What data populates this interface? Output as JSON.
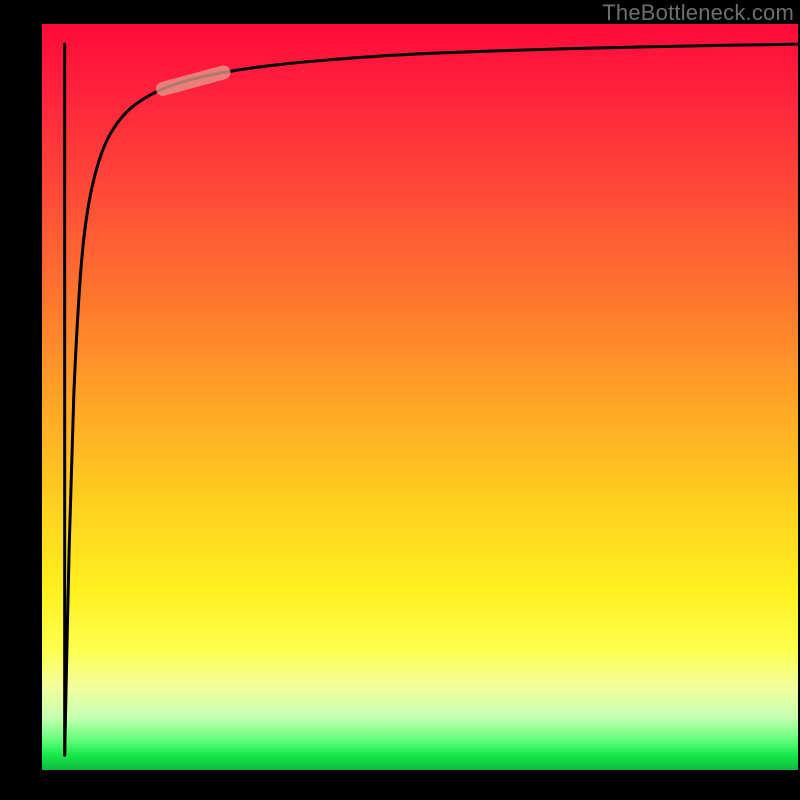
{
  "watermark": "TheBottleneck.com",
  "chart_data": {
    "type": "line",
    "title": "",
    "xlabel": "",
    "ylabel": "",
    "xlim": [
      0,
      100
    ],
    "ylim": [
      0,
      100
    ],
    "grid": false,
    "legend": false,
    "annotations": [],
    "series": [
      {
        "name": "bottleneck-curve",
        "x": [
          3.0,
          3.6,
          4.2,
          4.8,
          5.4,
          6.2,
          7.2,
          8.4,
          9.8,
          11.5,
          13.5,
          16.0,
          19.5,
          24.0,
          30.0,
          38.0,
          48.0,
          60.0,
          74.0,
          88.0,
          100.0
        ],
        "y": [
          2.0,
          30.0,
          50.0,
          62.0,
          70.0,
          76.0,
          80.5,
          84.0,
          86.5,
          88.5,
          90.0,
          91.3,
          92.5,
          93.5,
          94.4,
          95.2,
          95.9,
          96.4,
          96.8,
          97.1,
          97.3
        ]
      },
      {
        "name": "vertical-drop",
        "x": [
          3.0,
          3.0
        ],
        "y": [
          97.3,
          2.0
        ]
      },
      {
        "name": "highlight-segment",
        "x": [
          16.0,
          24.0
        ],
        "y": [
          91.3,
          93.5
        ]
      }
    ],
    "colors": {
      "curve": "#000000",
      "highlight": "#e69a8a",
      "gradient_top": "#ff0a3a",
      "gradient_mid": "#ffd21f",
      "gradient_bottom": "#0cba3e"
    }
  }
}
